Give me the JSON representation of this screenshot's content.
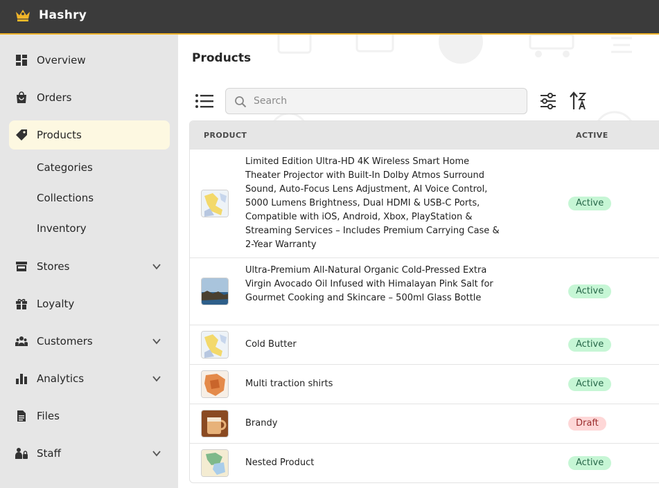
{
  "app": {
    "name": "Hashry"
  },
  "sidebar": {
    "items": [
      {
        "key": "overview",
        "label": "Overview",
        "icon": "dashboard-icon",
        "active": false,
        "expandable": false
      },
      {
        "key": "orders",
        "label": "Orders",
        "icon": "shopping-bag-icon",
        "active": false,
        "expandable": false
      },
      {
        "key": "products",
        "label": "Products",
        "icon": "tag-icon",
        "active": true,
        "expandable": false
      },
      {
        "key": "stores",
        "label": "Stores",
        "icon": "store-icon",
        "active": false,
        "expandable": true
      },
      {
        "key": "loyalty",
        "label": "Loyalty",
        "icon": "gift-icon",
        "active": false,
        "expandable": false
      },
      {
        "key": "customers",
        "label": "Customers",
        "icon": "users-icon",
        "active": false,
        "expandable": true
      },
      {
        "key": "analytics",
        "label": "Analytics",
        "icon": "bar-chart-icon",
        "active": false,
        "expandable": true
      },
      {
        "key": "files",
        "label": "Files",
        "icon": "file-icon",
        "active": false,
        "expandable": false
      },
      {
        "key": "staff",
        "label": "Staff",
        "icon": "staff-icon",
        "active": false,
        "expandable": true
      }
    ],
    "product_subitems": [
      "Categories",
      "Collections",
      "Inventory"
    ]
  },
  "main": {
    "title": "Products",
    "search": {
      "placeholder": "Search",
      "value": ""
    },
    "table": {
      "columns": [
        "PRODUCT",
        "ACTIVE"
      ],
      "rows": [
        {
          "name": "Limited Edition Ultra-HD 4K Wireless Smart Home Theater Projector with Built-In Dolby Atmos Surround Sound, Auto-Focus Lens Adjustment, AI Voice Control, 5000 Lumens Brightness, Dual HDMI & USB-C Ports, Compatible with iOS, Android, Xbox, PlayStation & Streaming Services – Includes Premium Carrying Case & 2-Year Warranty",
          "status": "Active",
          "thumbnail": "map-thumbnail-blue-yellow"
        },
        {
          "name": "Ultra-Premium All-Natural Organic Cold-Pressed Extra Virgin Avocado Oil Infused with Himalayan Pink Salt for Gourmet Cooking and Skincare – 500ml Glass Bottle",
          "status": "Active",
          "thumbnail": "coastline-photo-thumbnail"
        },
        {
          "name": "Cold Butter",
          "status": "Active",
          "thumbnail": "map-thumbnail-blue-yellow"
        },
        {
          "name": "Multi traction shirts",
          "status": "Active",
          "thumbnail": "map-thumbnail-orange"
        },
        {
          "name": "Brandy",
          "status": "Draft",
          "thumbnail": "mug-photo-thumbnail"
        },
        {
          "name": "Nested Product",
          "status": "Active",
          "thumbnail": "map-thumbnail-green"
        }
      ]
    }
  },
  "colors": {
    "topbar": "#3b3b3b",
    "accent": "#f0b429",
    "sidebar_bg": "#e6e6e6",
    "active_item_bg": "#fdf8e1",
    "active_badge_bg": "#c6f6d5",
    "draft_badge_bg": "#fed7d7"
  }
}
